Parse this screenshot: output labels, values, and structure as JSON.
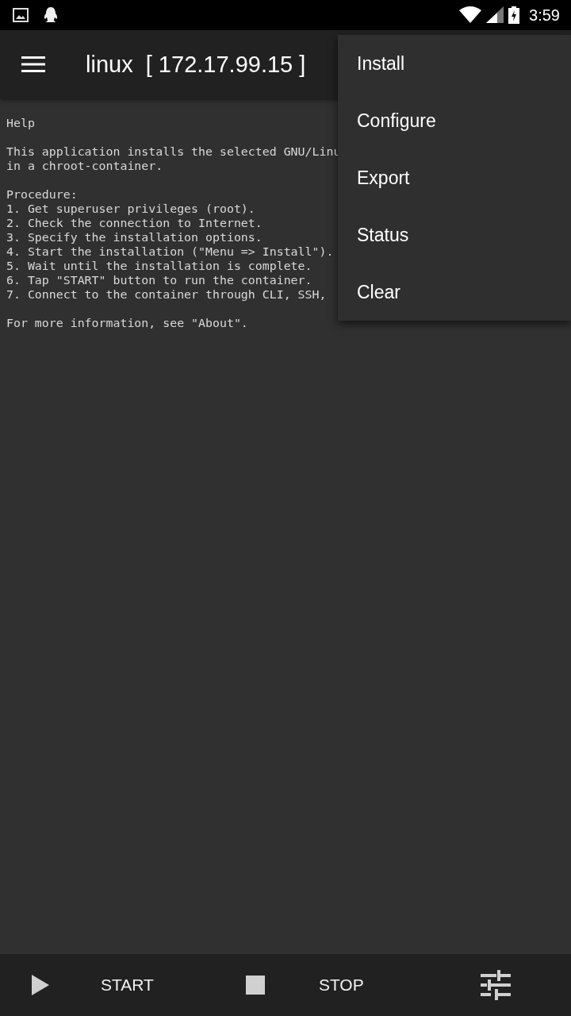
{
  "status_bar": {
    "time": "3:59"
  },
  "app_bar": {
    "title": "linux  [ 172.17.99.15 ]"
  },
  "log": [
    {
      "lines": [
        "Help"
      ]
    },
    {
      "lines": [
        "This application installs the selected GNU/Linu",
        "in a chroot-container."
      ]
    },
    {
      "lines": [
        "Procedure:",
        "1. Get superuser privileges (root).",
        "2. Check the connection to Internet.",
        "3. Specify the installation options.",
        "4. Start the installation (\"Menu => Install\").",
        "5. Wait until the installation is complete.",
        "6. Tap \"START\" button to run the container.",
        "7. Connect to the container through CLI, SSH,"
      ]
    },
    {
      "lines": [
        "For more information, see \"About\"."
      ]
    }
  ],
  "menu": {
    "items": [
      "Install",
      "Configure",
      "Export",
      "Status",
      "Clear"
    ]
  },
  "bottom_bar": {
    "buttons": [
      {
        "kind": "start",
        "label": "START"
      },
      {
        "kind": "stop",
        "label": "STOP"
      },
      {
        "kind": "settings"
      }
    ]
  }
}
